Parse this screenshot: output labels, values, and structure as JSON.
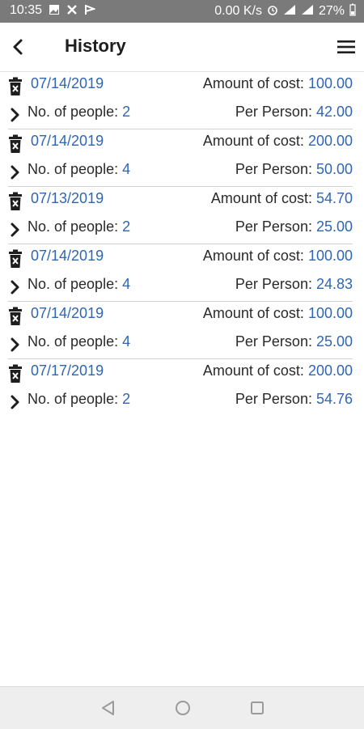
{
  "status_bar": {
    "time": "10:35",
    "net_speed": "0.00 K/s",
    "battery": "27%"
  },
  "header": {
    "title": "History"
  },
  "labels": {
    "amount_of_cost": "Amount of cost: ",
    "no_of_people": "No. of people: ",
    "per_person": "Per Person: "
  },
  "entries": [
    {
      "date": "07/14/2019",
      "cost": "100.00",
      "people": "2",
      "per_person": "42.00"
    },
    {
      "date": "07/14/2019",
      "cost": "200.00",
      "people": "4",
      "per_person": "50.00"
    },
    {
      "date": "07/13/2019",
      "cost": "54.70",
      "people": "2",
      "per_person": "25.00"
    },
    {
      "date": "07/14/2019",
      "cost": "100.00",
      "people": "4",
      "per_person": "24.83"
    },
    {
      "date": "07/14/2019",
      "cost": "100.00",
      "people": "4",
      "per_person": "25.00"
    },
    {
      "date": "07/17/2019",
      "cost": "200.00",
      "people": "2",
      "per_person": "54.76"
    }
  ],
  "colors": {
    "accent_blue": "#2f66b3",
    "status_bar": "#7a7a7a",
    "nav_bar": "#eeeeee"
  },
  "icons": {
    "back": "back-arrow-icon",
    "menu": "hamburger-menu-icon",
    "delete": "trash-icon",
    "expand": "chevron-right-icon",
    "nav_back": "triangle-back-icon",
    "nav_home": "circle-home-icon",
    "nav_recents": "square-recents-icon"
  }
}
